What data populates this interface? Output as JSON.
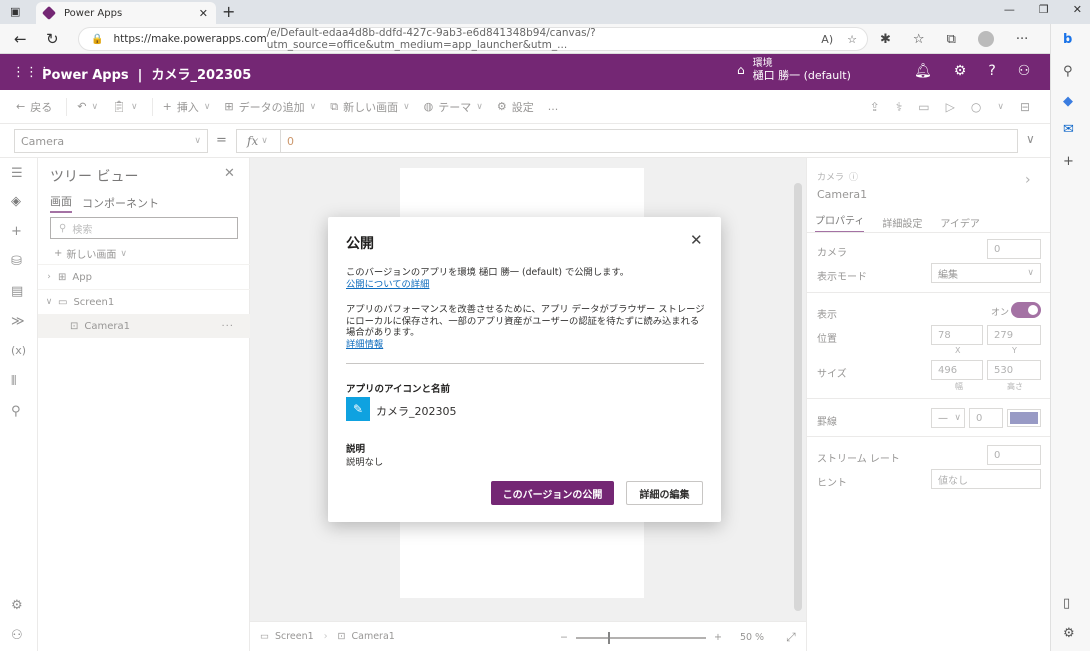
{
  "browser": {
    "tab_title": "Power Apps",
    "url_domain": "https://make.powerapps.com",
    "url_path": "/e/Default-edaa4d8b-ddfd-427c-9ab3-e6d841348b94/canvas/?utm_source=office&utm_medium=app_launcher&utm_..."
  },
  "header": {
    "app_title": "Power Apps  |  カメラ_202305",
    "env_label": "環境",
    "env_name": "樋口 勝一 (default)"
  },
  "command_bar": {
    "back": "戻る",
    "insert": "挿入",
    "add_data": "データの追加",
    "new_screen": "新しい画面",
    "theme": "テーマ",
    "settings": "設定",
    "more": "..."
  },
  "formula_bar": {
    "property": "Camera",
    "equals": "=",
    "fx": "fx",
    "formula": "0"
  },
  "tree": {
    "title": "ツリー ビュー",
    "tabs": [
      "画面",
      "コンポーネント"
    ],
    "search_placeholder": "検索",
    "new_screen": "新しい画面",
    "items": [
      {
        "label": "App"
      },
      {
        "label": "Screen1"
      },
      {
        "label": "Camera1"
      }
    ]
  },
  "statusbar": {
    "screen": "Screen1",
    "control": "Camera1",
    "zoom": "50 %"
  },
  "properties": {
    "kind": "カメラ",
    "name": "Camera1",
    "tabs": [
      "プロパティ",
      "詳細設定",
      "アイデア"
    ],
    "camera_label": "カメラ",
    "camera_value": "0",
    "display_mode_label": "表示モード",
    "display_mode_value": "編集",
    "visible_label": "表示",
    "visible_value": "オン",
    "position_label": "位置",
    "x": "78",
    "y": "279",
    "x_label": "X",
    "y_label": "Y",
    "size_label": "サイズ",
    "width": "496",
    "height": "530",
    "width_label": "幅",
    "height_label": "高さ",
    "border_label": "罫線",
    "border_style": "—",
    "border_width": "0",
    "stream_rate_label": "ストリーム レート",
    "stream_rate_value": "0",
    "hint_label": "ヒント",
    "hint_value": "値なし"
  },
  "dialog": {
    "title": "公開",
    "line1": "このバージョンのアプリを環境 樋口 勝一 (default) で公開します。",
    "link1": "公開についての詳細",
    "para2": "アプリのパフォーマンスを改善させるために、アプリ データがブラウザー ストレージにローカルに保存され、一部のアプリ資産がユーザーの認証を待たずに読み込まれる場合があります。",
    "link2": "詳細情報",
    "icon_heading": "アプリのアイコンと名前",
    "app_name": "カメラ_202305",
    "desc_heading": "説明",
    "desc_value": "説明なし",
    "publish_button": "このバージョンの公開",
    "edit_button": "詳細の編集"
  },
  "colors": {
    "brand": "#742774",
    "link": "#0f6cbd",
    "app_icon": "#0fa2e0"
  }
}
